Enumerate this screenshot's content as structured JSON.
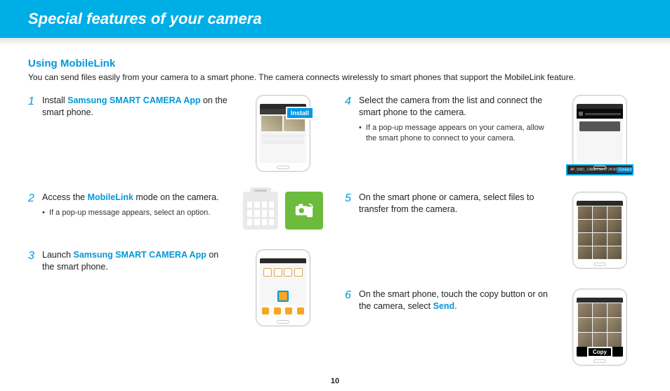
{
  "banner_title": "Special features of your camera",
  "section": {
    "title": "Using MobileLink",
    "description": "You can send files easily from your camera to a smart phone. The camera connects wirelessly to smart phones that support the MobileLink feature."
  },
  "steps": [
    {
      "num": "1",
      "text_pre": "Install ",
      "hl": "Samsung SMART CAMERA App",
      "text_post": " on the smart phone.",
      "badge": "Install"
    },
    {
      "num": "2",
      "text_pre": "Access the ",
      "hl": "MobileLink",
      "text_post": " mode on the camera.",
      "sub": "If a pop-up message appears, select an option."
    },
    {
      "num": "3",
      "text_pre": "Launch ",
      "hl": "Samsung SMART CAMERA App",
      "text_post": " on the smart phone."
    },
    {
      "num": "4",
      "text": "Select the camera from the list and connect the smart phone to the camera.",
      "sub": "If a pop-up message appears on your camera, allow the smart phone to connect to your camera.",
      "connect_label": "AP_SSID_ CAMETSA-07 24 00",
      "connect_btn": "Connect"
    },
    {
      "num": "5",
      "text": "On the smart phone or camera, select files to transfer from the camera."
    },
    {
      "num": "6",
      "text_pre": "On the smart phone, touch the copy button or on the camera, select ",
      "hl": "Send",
      "text_post": ".",
      "badge": "Copy"
    }
  ],
  "page_number": "10",
  "icons": {
    "mobilelink": "camera-sync-icon"
  },
  "colors": {
    "brand": "#00aee6",
    "accent": "#0099d9",
    "app_green": "#6cbb3c"
  }
}
